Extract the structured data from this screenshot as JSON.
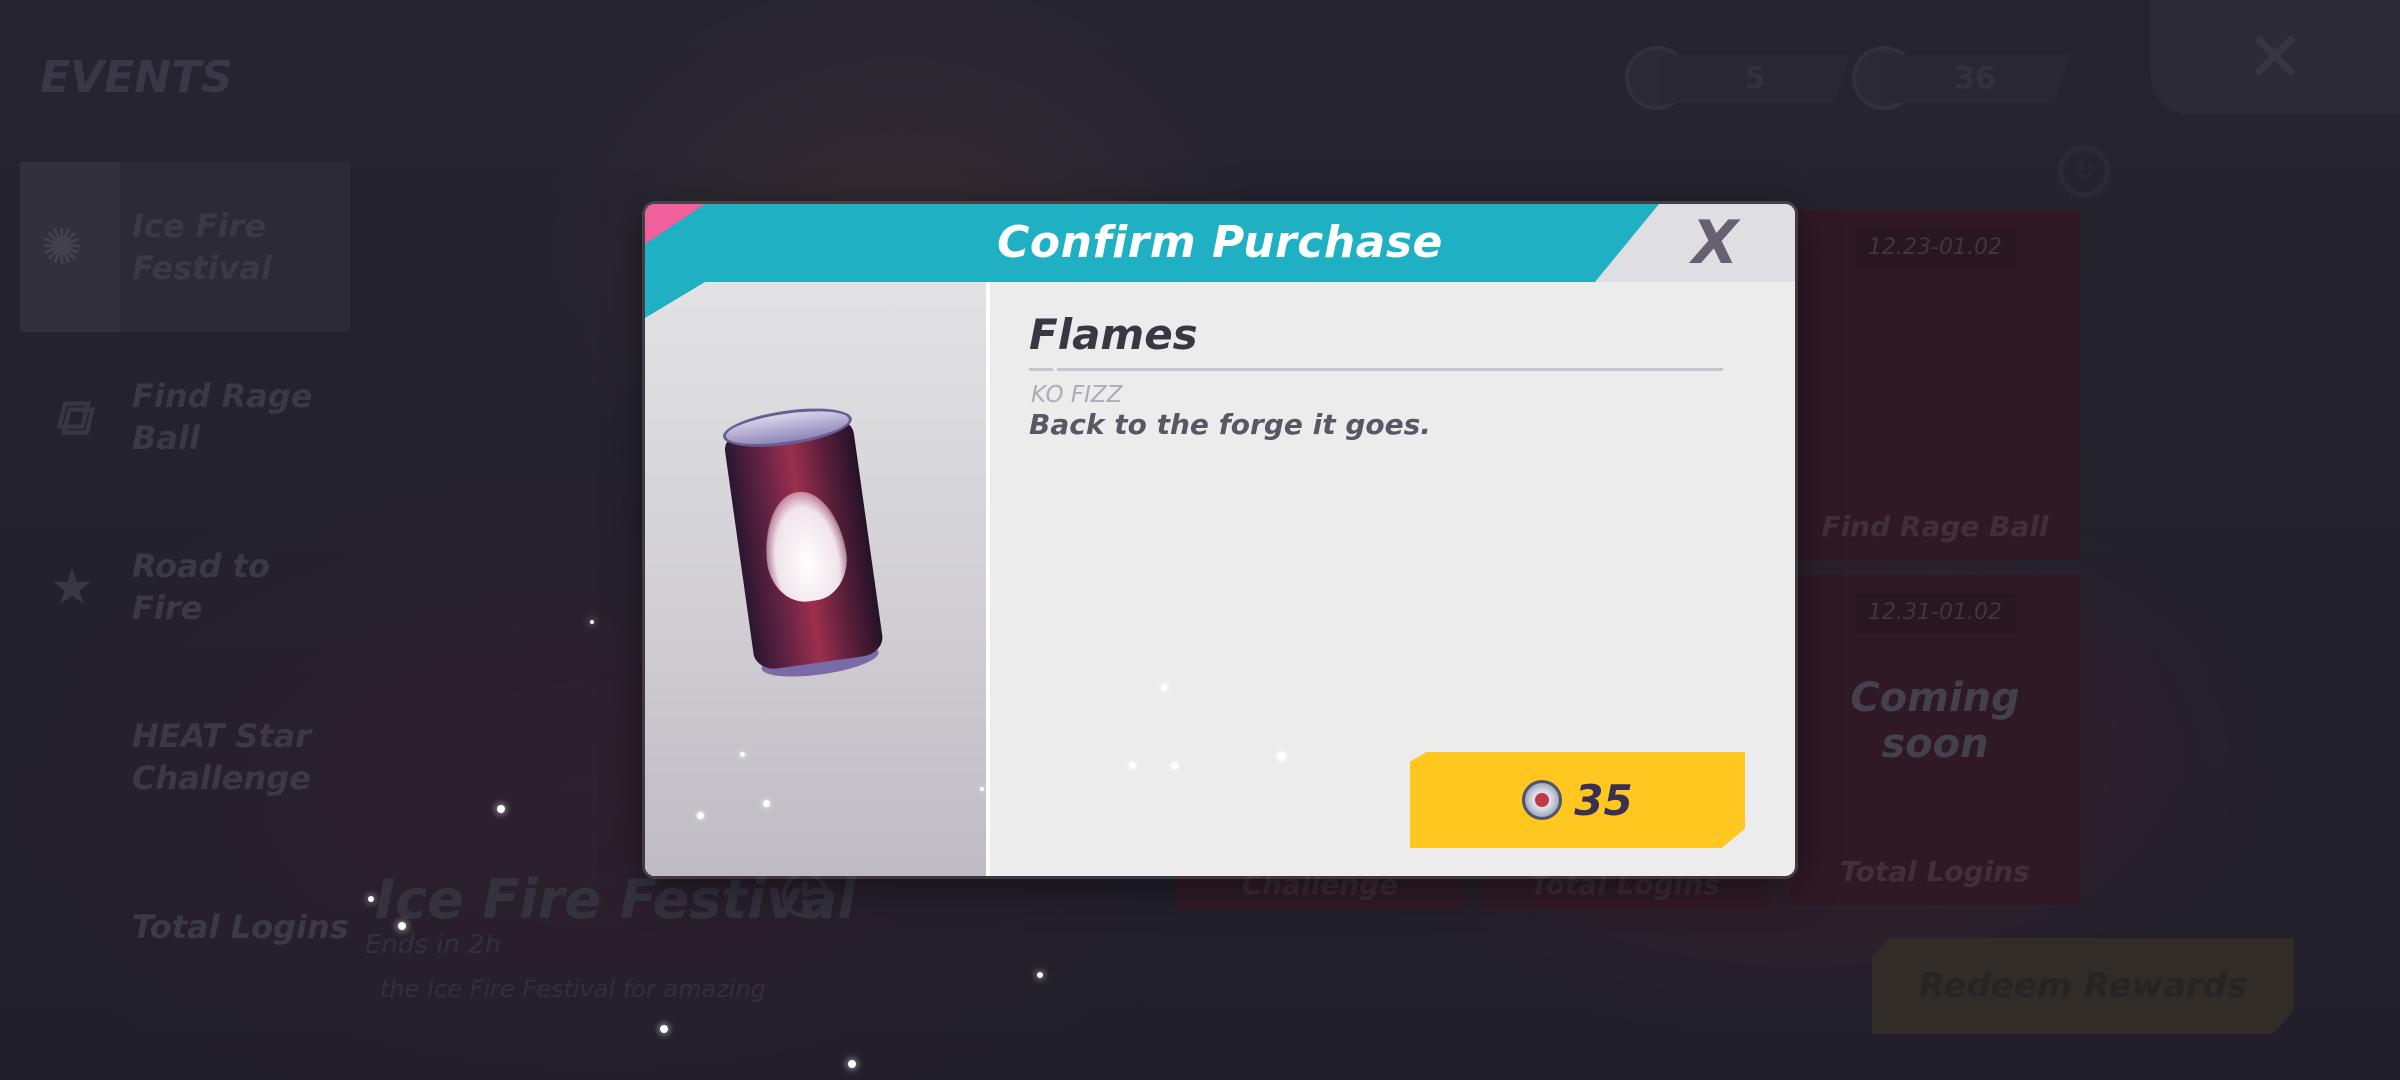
{
  "background": {
    "events_title": "EVENTS",
    "sidebar": [
      {
        "label": "Ice Fire Festival",
        "icon": "fire-wheel-icon",
        "active": true
      },
      {
        "label": "Find Rage Ball",
        "icon": "gift-icon",
        "active": false
      },
      {
        "label": "Road to Fire",
        "icon": "star-trophy-icon",
        "active": false
      },
      {
        "label": "HEAT Star Challenge",
        "icon": "",
        "active": false
      },
      {
        "label": "Total Logins",
        "icon": "",
        "active": false
      }
    ],
    "currencies": [
      {
        "icon": "gear-badge-icon",
        "value": "5"
      },
      {
        "icon": "ko-coin-icon",
        "value": "36"
      }
    ],
    "cards": [
      {
        "date": "12.23-01.02",
        "label": "Find Rage Ball"
      },
      {
        "date": "12.31-01.02",
        "label": "Total Logins",
        "status": "Coming soon"
      }
    ],
    "bottom_cards": [
      "Challenge",
      "Total Logins",
      "Total Logins"
    ],
    "festival_title": "Ice Fire Festival",
    "festival_sub": "Ends in 2h",
    "festival_desc": "the Ice Fire Festival for amazing",
    "redeem_label": "Redeem Rewards",
    "accent_colors": {
      "teal": "#1fb0c4",
      "pink": "#f0609a",
      "gold": "#ffc71f"
    }
  },
  "modal": {
    "title": "Confirm Purchase",
    "close_label": "X",
    "item": {
      "name": "Flames",
      "category": "KO FIZZ",
      "description": "Back to the forge it goes.",
      "image": "soda-can-flame-icon"
    },
    "price": {
      "currency_icon": "ko-coin-icon",
      "amount": "35"
    }
  }
}
